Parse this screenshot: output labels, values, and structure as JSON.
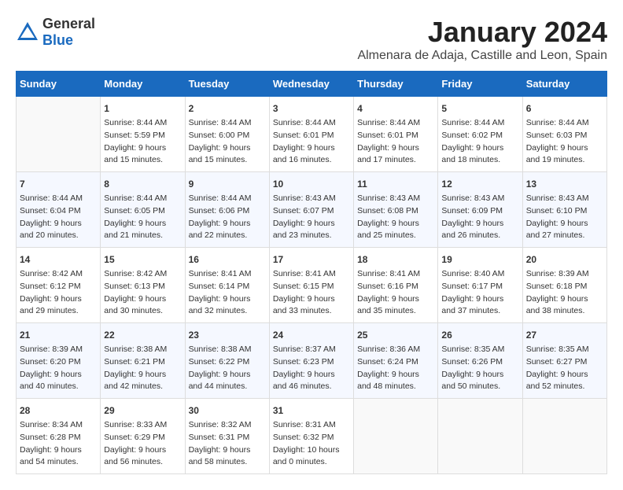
{
  "header": {
    "logo": {
      "general": "General",
      "blue": "Blue"
    },
    "title": "January 2024",
    "location": "Almenara de Adaja, Castille and Leon, Spain"
  },
  "calendar": {
    "days_of_week": [
      "Sunday",
      "Monday",
      "Tuesday",
      "Wednesday",
      "Thursday",
      "Friday",
      "Saturday"
    ],
    "weeks": [
      [
        {
          "day": "",
          "content": ""
        },
        {
          "day": "1",
          "content": "Sunrise: 8:44 AM\nSunset: 5:59 PM\nDaylight: 9 hours\nand 15 minutes."
        },
        {
          "day": "2",
          "content": "Sunrise: 8:44 AM\nSunset: 6:00 PM\nDaylight: 9 hours\nand 15 minutes."
        },
        {
          "day": "3",
          "content": "Sunrise: 8:44 AM\nSunset: 6:01 PM\nDaylight: 9 hours\nand 16 minutes."
        },
        {
          "day": "4",
          "content": "Sunrise: 8:44 AM\nSunset: 6:01 PM\nDaylight: 9 hours\nand 17 minutes."
        },
        {
          "day": "5",
          "content": "Sunrise: 8:44 AM\nSunset: 6:02 PM\nDaylight: 9 hours\nand 18 minutes."
        },
        {
          "day": "6",
          "content": "Sunrise: 8:44 AM\nSunset: 6:03 PM\nDaylight: 9 hours\nand 19 minutes."
        }
      ],
      [
        {
          "day": "7",
          "content": "Sunrise: 8:44 AM\nSunset: 6:04 PM\nDaylight: 9 hours\nand 20 minutes."
        },
        {
          "day": "8",
          "content": "Sunrise: 8:44 AM\nSunset: 6:05 PM\nDaylight: 9 hours\nand 21 minutes."
        },
        {
          "day": "9",
          "content": "Sunrise: 8:44 AM\nSunset: 6:06 PM\nDaylight: 9 hours\nand 22 minutes."
        },
        {
          "day": "10",
          "content": "Sunrise: 8:43 AM\nSunset: 6:07 PM\nDaylight: 9 hours\nand 23 minutes."
        },
        {
          "day": "11",
          "content": "Sunrise: 8:43 AM\nSunset: 6:08 PM\nDaylight: 9 hours\nand 25 minutes."
        },
        {
          "day": "12",
          "content": "Sunrise: 8:43 AM\nSunset: 6:09 PM\nDaylight: 9 hours\nand 26 minutes."
        },
        {
          "day": "13",
          "content": "Sunrise: 8:43 AM\nSunset: 6:10 PM\nDaylight: 9 hours\nand 27 minutes."
        }
      ],
      [
        {
          "day": "14",
          "content": "Sunrise: 8:42 AM\nSunset: 6:12 PM\nDaylight: 9 hours\nand 29 minutes."
        },
        {
          "day": "15",
          "content": "Sunrise: 8:42 AM\nSunset: 6:13 PM\nDaylight: 9 hours\nand 30 minutes."
        },
        {
          "day": "16",
          "content": "Sunrise: 8:41 AM\nSunset: 6:14 PM\nDaylight: 9 hours\nand 32 minutes."
        },
        {
          "day": "17",
          "content": "Sunrise: 8:41 AM\nSunset: 6:15 PM\nDaylight: 9 hours\nand 33 minutes."
        },
        {
          "day": "18",
          "content": "Sunrise: 8:41 AM\nSunset: 6:16 PM\nDaylight: 9 hours\nand 35 minutes."
        },
        {
          "day": "19",
          "content": "Sunrise: 8:40 AM\nSunset: 6:17 PM\nDaylight: 9 hours\nand 37 minutes."
        },
        {
          "day": "20",
          "content": "Sunrise: 8:39 AM\nSunset: 6:18 PM\nDaylight: 9 hours\nand 38 minutes."
        }
      ],
      [
        {
          "day": "21",
          "content": "Sunrise: 8:39 AM\nSunset: 6:20 PM\nDaylight: 9 hours\nand 40 minutes."
        },
        {
          "day": "22",
          "content": "Sunrise: 8:38 AM\nSunset: 6:21 PM\nDaylight: 9 hours\nand 42 minutes."
        },
        {
          "day": "23",
          "content": "Sunrise: 8:38 AM\nSunset: 6:22 PM\nDaylight: 9 hours\nand 44 minutes."
        },
        {
          "day": "24",
          "content": "Sunrise: 8:37 AM\nSunset: 6:23 PM\nDaylight: 9 hours\nand 46 minutes."
        },
        {
          "day": "25",
          "content": "Sunrise: 8:36 AM\nSunset: 6:24 PM\nDaylight: 9 hours\nand 48 minutes."
        },
        {
          "day": "26",
          "content": "Sunrise: 8:35 AM\nSunset: 6:26 PM\nDaylight: 9 hours\nand 50 minutes."
        },
        {
          "day": "27",
          "content": "Sunrise: 8:35 AM\nSunset: 6:27 PM\nDaylight: 9 hours\nand 52 minutes."
        }
      ],
      [
        {
          "day": "28",
          "content": "Sunrise: 8:34 AM\nSunset: 6:28 PM\nDaylight: 9 hours\nand 54 minutes."
        },
        {
          "day": "29",
          "content": "Sunrise: 8:33 AM\nSunset: 6:29 PM\nDaylight: 9 hours\nand 56 minutes."
        },
        {
          "day": "30",
          "content": "Sunrise: 8:32 AM\nSunset: 6:31 PM\nDaylight: 9 hours\nand 58 minutes."
        },
        {
          "day": "31",
          "content": "Sunrise: 8:31 AM\nSunset: 6:32 PM\nDaylight: 10 hours\nand 0 minutes."
        },
        {
          "day": "",
          "content": ""
        },
        {
          "day": "",
          "content": ""
        },
        {
          "day": "",
          "content": ""
        }
      ]
    ]
  }
}
